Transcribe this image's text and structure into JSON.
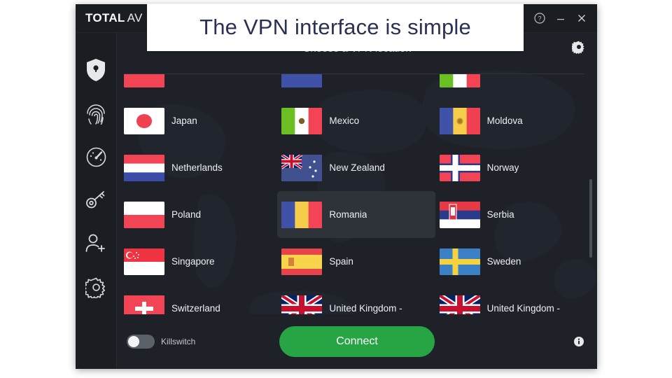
{
  "caption": {
    "text": "The VPN interface is simple"
  },
  "window": {
    "brand_total": "TOTAL",
    "brand_av": "AV",
    "controls": [
      {
        "name": "help-button",
        "label": "?"
      },
      {
        "name": "minimize-button",
        "label": "—"
      },
      {
        "name": "close-button",
        "label": "✕"
      }
    ]
  },
  "sidebar": {
    "items": [
      {
        "icon": "shield-lock-icon",
        "label": "Protection",
        "active": true
      },
      {
        "icon": "fingerprint-icon",
        "label": "Identity",
        "active": false
      },
      {
        "icon": "speedometer-icon",
        "label": "Performance",
        "active": false
      },
      {
        "icon": "key-icon",
        "label": "Password Vault",
        "active": false
      },
      {
        "icon": "user-add-icon",
        "label": "Account",
        "active": false
      },
      {
        "icon": "gear-icon",
        "label": "Settings",
        "active": false
      }
    ]
  },
  "main": {
    "title": "Choose a VPN location",
    "settings_icon": "gear-icon",
    "scrollbar": {
      "name": "vertical-scrollbar"
    }
  },
  "locations": [
    {
      "name": "",
      "flag": "partial-red",
      "partial": true,
      "selected": false
    },
    {
      "name": "",
      "flag": "partial-blue",
      "partial": true,
      "selected": false
    },
    {
      "name": "",
      "flag": "partial-italy",
      "partial": true,
      "selected": false
    },
    {
      "name": "Japan",
      "flag": "jp",
      "selected": false
    },
    {
      "name": "Mexico",
      "flag": "mx",
      "selected": false
    },
    {
      "name": "Moldova",
      "flag": "md",
      "selected": false
    },
    {
      "name": "Netherlands",
      "flag": "nl",
      "selected": false
    },
    {
      "name": "New Zealand",
      "flag": "nz",
      "selected": false
    },
    {
      "name": "Norway",
      "flag": "no",
      "selected": false
    },
    {
      "name": "Poland",
      "flag": "pl",
      "selected": false
    },
    {
      "name": "Romania",
      "flag": "ro",
      "selected": true
    },
    {
      "name": "Serbia",
      "flag": "rs",
      "selected": false
    },
    {
      "name": "Singapore",
      "flag": "sg",
      "selected": false
    },
    {
      "name": "Spain",
      "flag": "es",
      "selected": false
    },
    {
      "name": "Sweden",
      "flag": "se",
      "selected": false
    },
    {
      "name": "Switzerland",
      "flag": "ch",
      "selected": false
    },
    {
      "name": "United Kingdom -",
      "flag": "gb",
      "selected": false
    },
    {
      "name": "United Kingdom -",
      "flag": "gb",
      "selected": false
    }
  ],
  "bottom": {
    "killswitch_label": "Killswitch",
    "killswitch_on": false,
    "connect_label": "Connect",
    "info_icon": "info-icon"
  },
  "colors": {
    "window_bg": "#1e2228",
    "chrome_bg": "#1a1e23",
    "accent_green": "#27a544",
    "selected_row": "#2e333a",
    "text_primary": "#eef0f3",
    "text_muted": "#c9ced6",
    "caption_text": "#2b3154"
  }
}
